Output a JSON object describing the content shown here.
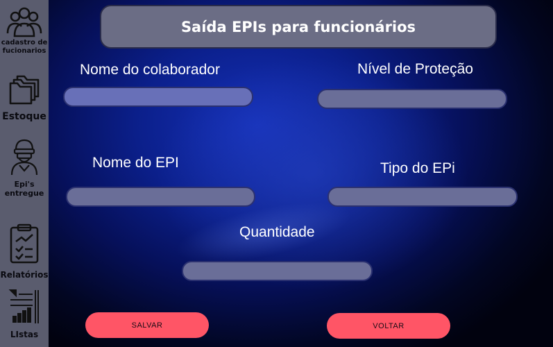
{
  "sidebar": {
    "items": [
      {
        "label_line1": "cadastro de",
        "label_line2": "fucionarios",
        "icon": "users-icon"
      },
      {
        "label": "Estoque",
        "icon": "folders-icon"
      },
      {
        "label_line1": "Epi's",
        "label_line2": "entregue",
        "icon": "protective-worker-icon"
      },
      {
        "label": "Relatórios",
        "icon": "clipboard-chart-icon"
      },
      {
        "label": "LIstas",
        "icon": "list-chart-icon"
      }
    ]
  },
  "header": {
    "title": "Saída EPIs para funcionários"
  },
  "form": {
    "collaborator_label": "Nome do colaborador",
    "protection_level_label": "Nível de Proteção",
    "epi_name_label": "Nome do EPI",
    "epi_type_label": "Tipo do EPi",
    "quantity_label": "Quantidade"
  },
  "buttons": {
    "save": "SALVAR",
    "back": "VOLTAR"
  },
  "colors": {
    "sidebar_bg": "#5a5c6e",
    "button_accent": "#ff5566",
    "input_bg": "#6870b8",
    "title_bg": "#6b6d85"
  }
}
